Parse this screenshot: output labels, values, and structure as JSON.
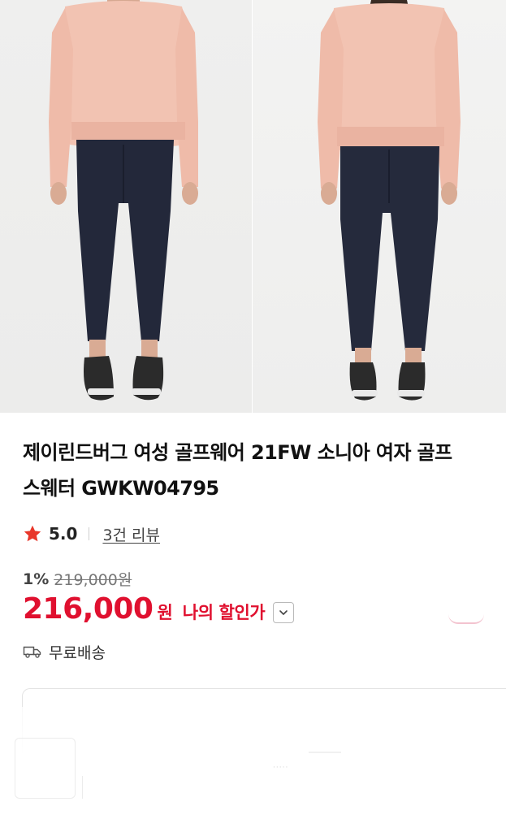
{
  "product": {
    "title": "제이린드버그 여성 골프웨어 21FW 소니아 여자 골프 스웨터 GWKW04795",
    "images": [
      {
        "alt": "front-view",
        "icon": "model-front-icon"
      },
      {
        "alt": "back-view",
        "icon": "model-back-icon"
      }
    ]
  },
  "rating": {
    "score": "5.0",
    "review_link": "3건 리뷰",
    "star_color": "#e8372a"
  },
  "price": {
    "discount_rate": "1%",
    "original": "219,000원",
    "sale": "216,000",
    "currency": "원",
    "my_discount_label": "나의 할인가",
    "accent_color": "#e0102f"
  },
  "shipping": {
    "label": "무료배송",
    "icon": "truck-icon"
  },
  "bottom": {
    "faint_text": "·····"
  }
}
